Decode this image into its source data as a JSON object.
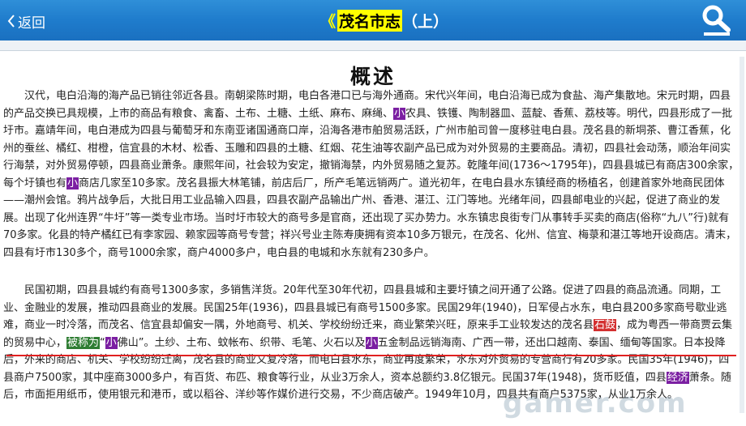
{
  "nav": {
    "back_label": "返回",
    "title_prefix": "《",
    "title_highlight": "茂名市志",
    "title_suffix": "（上）"
  },
  "article": {
    "heading": "概述",
    "p1": [
      {
        "t": "　　汉代，电白沿海的海产品已销往邻近各县。南朝梁陈时期，电白各港口已与海外通商。宋代兴年间，电白沿海已成为食盐、海产集散地。宋元时期，四县的产品交换已具规模，上市的商品有粮食、禽畜、土布、土糖、土纸、麻布、麻绳、"
      },
      {
        "t": "小",
        "c": "m"
      },
      {
        "t": "农具、铁镬、陶制器皿、蓝靛、香蕉、荔枝等。明代，四县形成了一批圩市。嘉靖年间，电白港成为四县与葡萄牙和东南亚诸国通商口岸，沿海各港市舶贸易活跃，广州市舶司曾一度移驻电白县。茂名县的新垌茶、曹江香蕉，化州的蚕丝、橘红、柑橙，信宜县的木材、松香、玉雕和四县的土糖、红烟、花生油等农副产品已成为对外贸易的主要商品。清初，四县社会动荡，顺治年间实行海禁，对外贸易停顿，四县商业萧条。康熙年间，社会较为安定，撤销海禁，内外贸易随之复苏。乾隆年间(1736～1795年)，四县县城已有商店300余家，每个圩镇也有"
      },
      {
        "t": "小",
        "c": "m"
      },
      {
        "t": "商店几家至10多家。茂名县振大林笔铺，前店后厂，所产毛笔远销两广。道光初年，在电白县水东镇经商的杨植名，创建首家外地商民团体——潮州会馆。鸦片战争后，大批日用工业品输入四县，四县农副产品输出广州、香港、湛江、江门等地。光绪年间，四县邮电业的兴起，促进了商业的发展。出现了化州连界“牛圩”等一类专业市场。当时圩市较大的商号多是官商，还出现了买办势力。水东镇忠良街专门从事转手买卖的商店(俗称“九八”行)就有70多家。化县的特产橘红已有李家园、赖家园等商号专营；祥兴号业主陈寿庚拥有资本10多万银元，在茂名、化州、信宜、梅菉和湛江等地开设商店。清末，四县有圩市130多个，商号1000余家，商户4000多户，电白县的电城和水东就有230多户。"
      }
    ],
    "p2": [
      {
        "t": "　　民国初期，四县县城约有商号1300多家，多销售洋货。20年代至30年代初，四县县城和主要圩镇之间开通了公路。促进了四县的商品流通。同期，工业、金融业的发展，推动四县商业的发展。民国25年(1936)，四县县城已有商号1500多家。民国29年(1940)，日军侵占水东，电白县200多家商号歇业逃难，商业一时冷落，而茂名、信宜县却偏安一隅，外地商号、机关、学校纷纷迁来，商业繁荣兴旺，原来手工业较发达的茂名县"
      },
      {
        "t": "石鼓",
        "c": "r"
      },
      {
        "t": "，成为粤西一带商贾云集的贸易中心，"
      },
      {
        "t": "被称为",
        "c": "g"
      },
      {
        "t": "“"
      },
      {
        "t": "小",
        "c": "m"
      },
      {
        "t": "佛山”。土纱、土布、蚊帐布、织带、毛笔、火石以及"
      },
      {
        "t": "小",
        "c": "m"
      },
      {
        "t": "五金制品远销海南、广西一带，还出口越南、泰国、缅甸等国家。日本投降后，外来的商店、机关、学校纷纷迁离，茂名县的商业又复冷落，而电白县水东，商业再度繁荣，水东对外贸易的专营商行有20多家。民国35年(1946)，四县商户7500家，其中座商3000多户，有百货、布匹、粮食等行业，从业3万余人，资本总额约3.8亿银元。民国37年(1948)，货币贬值，四县"
      },
      {
        "t": "经济",
        "c": "m"
      },
      {
        "t": "萧条。随后，市面拒用纸币，使用银元和港币，或以稻谷、洋纱等作媒价进行交易，不少商店破产。1949年10月，四县共有商户5375家，从业1万余人。"
      }
    ]
  },
  "watermark": "gamer.com",
  "colors": {
    "header": "#1f7ccc",
    "highlight": "#ffff00",
    "mark": "#7b1fa2",
    "underline": "#e02020"
  },
  "icons": {
    "back": "chevron-left-icon",
    "search": "search-icon"
  }
}
